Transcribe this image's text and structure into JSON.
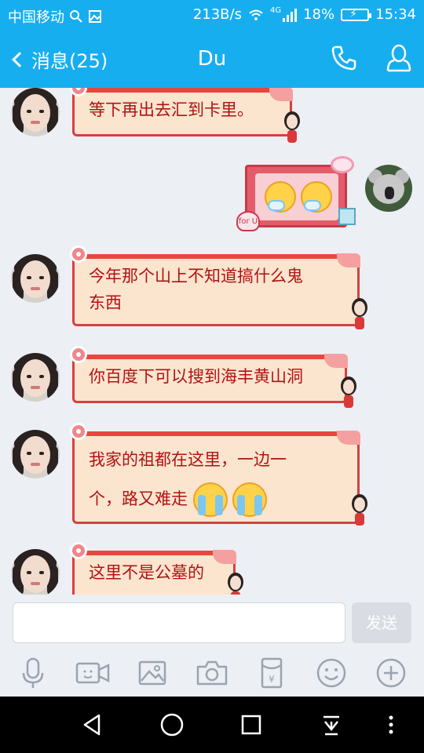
{
  "status_bar": {
    "carrier": "中国移动",
    "speed": "213B/s",
    "network": "4G",
    "battery": "18%",
    "time": "15:34"
  },
  "header": {
    "back_label": "消息(25)",
    "title": "Du"
  },
  "messages": [
    {
      "side": "left",
      "text": "等下再出去汇到卡里。"
    },
    {
      "side": "right",
      "type": "sticker"
    },
    {
      "side": "left",
      "text_lines": [
        "今年那个山上不知道搞什么鬼",
        "东西"
      ]
    },
    {
      "side": "left",
      "text": "你百度下可以搜到海丰黄山洞"
    },
    {
      "side": "left",
      "text_lines": [
        "我家的祖都在这里，一边一",
        "个，路又难走"
      ]
    },
    {
      "side": "left",
      "text": "这里不是公墓的"
    }
  ],
  "sticker": {
    "tag": "for U"
  },
  "input": {
    "placeholder": "",
    "send_label": "发送"
  },
  "toolbar": {
    "icons": [
      "microphone-icon",
      "video-icon",
      "image-icon",
      "camera-icon",
      "red-packet-icon",
      "emoji-icon",
      "plus-icon"
    ]
  },
  "colors": {
    "primary": "#17aef0",
    "bubble_bg": "#fbe5cf",
    "bubble_text": "#b01212",
    "bubble_border": "#d64040"
  }
}
